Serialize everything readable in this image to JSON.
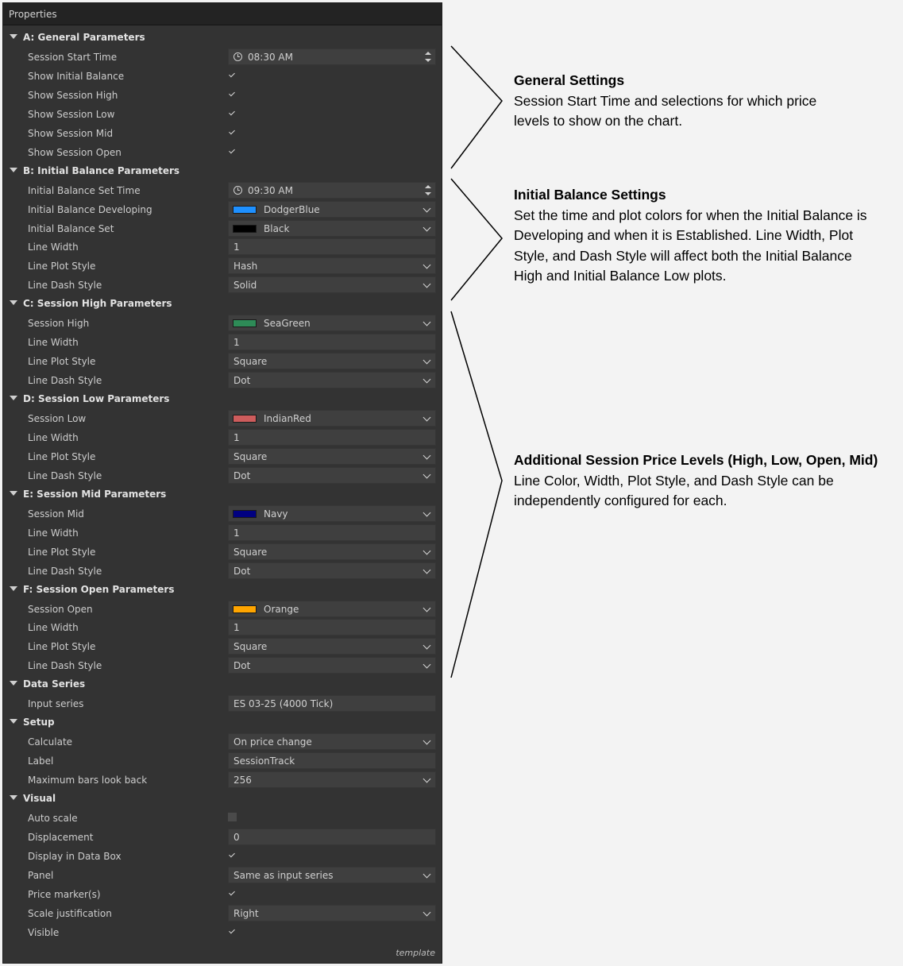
{
  "panel": {
    "title": "Properties",
    "footer_label": "template",
    "sections": [
      {
        "label": "A: General Parameters",
        "rows": [
          {
            "label": "Session Start Time",
            "type": "time",
            "value": "08:30 AM"
          },
          {
            "label": "Show Initial Balance",
            "type": "check",
            "checked": true
          },
          {
            "label": "Show Session High",
            "type": "check",
            "checked": true
          },
          {
            "label": "Show Session Low",
            "type": "check",
            "checked": true
          },
          {
            "label": "Show Session Mid",
            "type": "check",
            "checked": true
          },
          {
            "label": "Show Session Open",
            "type": "check",
            "checked": true
          }
        ]
      },
      {
        "label": "B: Initial Balance Parameters",
        "rows": [
          {
            "label": "Initial Balance Set Time",
            "type": "time",
            "value": "09:30 AM"
          },
          {
            "label": "Initial Balance Developing",
            "type": "color",
            "value": "DodgerBlue",
            "color": "#1e90ff"
          },
          {
            "label": "Initial Balance Set",
            "type": "color",
            "value": "Black",
            "color": "#000000"
          },
          {
            "label": "Line Width",
            "type": "text",
            "value": "1"
          },
          {
            "label": "Line Plot Style",
            "type": "select",
            "value": "Hash"
          },
          {
            "label": "Line Dash Style",
            "type": "select",
            "value": "Solid"
          }
        ]
      },
      {
        "label": "C: Session High Parameters",
        "rows": [
          {
            "label": "Session High",
            "type": "color",
            "value": "SeaGreen",
            "color": "#2e8b57"
          },
          {
            "label": "Line Width",
            "type": "text",
            "value": "1"
          },
          {
            "label": "Line Plot Style",
            "type": "select",
            "value": "Square"
          },
          {
            "label": "Line Dash Style",
            "type": "select",
            "value": "Dot"
          }
        ]
      },
      {
        "label": "D: Session Low Parameters",
        "rows": [
          {
            "label": "Session Low",
            "type": "color",
            "value": "IndianRed",
            "color": "#cd5c5c"
          },
          {
            "label": "Line Width",
            "type": "text",
            "value": "1"
          },
          {
            "label": "Line Plot Style",
            "type": "select",
            "value": "Square"
          },
          {
            "label": "Line Dash Style",
            "type": "select",
            "value": "Dot"
          }
        ]
      },
      {
        "label": "E: Session Mid Parameters",
        "rows": [
          {
            "label": "Session Mid",
            "type": "color",
            "value": "Navy",
            "color": "#000080"
          },
          {
            "label": "Line Width",
            "type": "text",
            "value": "1"
          },
          {
            "label": "Line Plot Style",
            "type": "select",
            "value": "Square"
          },
          {
            "label": "Line Dash Style",
            "type": "select",
            "value": "Dot"
          }
        ]
      },
      {
        "label": "F: Session Open Parameters",
        "rows": [
          {
            "label": "Session Open",
            "type": "color",
            "value": "Orange",
            "color": "#ffa500"
          },
          {
            "label": "Line Width",
            "type": "text",
            "value": "1"
          },
          {
            "label": "Line Plot Style",
            "type": "select",
            "value": "Square"
          },
          {
            "label": "Line Dash Style",
            "type": "select",
            "value": "Dot"
          }
        ]
      },
      {
        "label": "Data Series",
        "rows": [
          {
            "label": "Input series",
            "type": "text",
            "value": "ES 03-25 (4000 Tick)"
          }
        ]
      },
      {
        "label": "Setup",
        "rows": [
          {
            "label": "Calculate",
            "type": "select",
            "value": "On price change"
          },
          {
            "label": "Label",
            "type": "text",
            "value": "SessionTrack"
          },
          {
            "label": "Maximum bars look back",
            "type": "select",
            "value": "256"
          }
        ]
      },
      {
        "label": "Visual",
        "rows": [
          {
            "label": "Auto scale",
            "type": "check",
            "checked": false
          },
          {
            "label": "Displacement",
            "type": "text",
            "value": "0"
          },
          {
            "label": "Display in Data Box",
            "type": "check",
            "checked": true
          },
          {
            "label": "Panel",
            "type": "select",
            "value": "Same as input series"
          },
          {
            "label": "Price marker(s)",
            "type": "check",
            "checked": true
          },
          {
            "label": "Scale justification",
            "type": "select",
            "value": "Right"
          },
          {
            "label": "Visible",
            "type": "check",
            "checked": true
          }
        ]
      }
    ]
  },
  "annotations": [
    {
      "heading": "General Settings",
      "body": "Session Start Time and selections for which price levels to show on the chart."
    },
    {
      "heading": "Initial Balance Settings",
      "body": "Set the time and plot colors for when the Initial Balance is Developing and when it is Established. Line Width, Plot Style, and Dash Style will affect both the Initial Balance High and Initial Balance Low plots."
    },
    {
      "heading": "Additional Session Price Levels (High, Low, Open, Mid)",
      "body": "Line Color, Width, Plot Style, and Dash Style can be independently configured for each."
    }
  ]
}
